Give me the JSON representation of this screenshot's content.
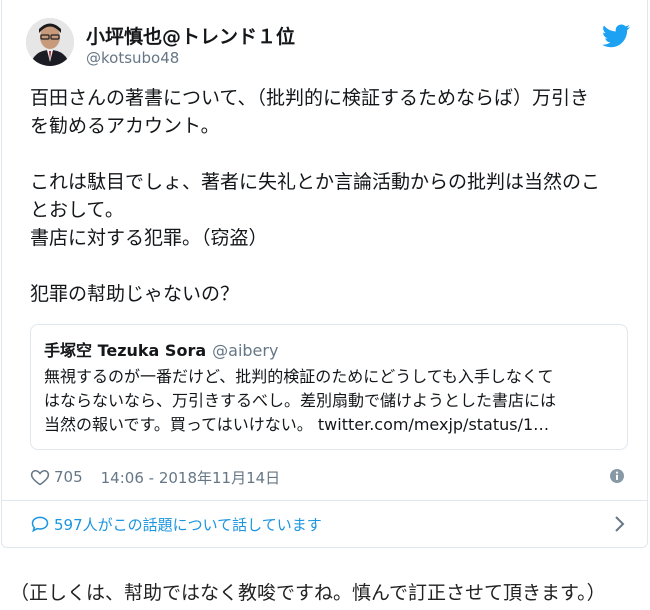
{
  "tweet": {
    "author_name": "小坪慎也@トレンド１位",
    "author_handle": "@kotsubo48",
    "lines": [
      "百田さんの著書について、（批判的に検証するためならば）万引き",
      "を勧めるアカウント。",
      "",
      "これは駄目でしょ、著者に失礼とか言論活動からの批判は当然のこ",
      "とおして。",
      "書店に対する犯罪。（窃盗）",
      "",
      "犯罪の幇助じゃないの？"
    ],
    "quote": {
      "name": "手塚空 Tezuka Sora",
      "handle": "@aibery",
      "lines": [
        "無視するのが一番だけど、批判的検証のためにどうしても入手しなくて",
        "はならないなら、万引きするべし。差別扇動で儲けようとした書店には",
        "当然の報いです。買ってはいけない。 twitter.com/mexjp/status/1…"
      ]
    },
    "likes": "705",
    "timestamp": "14:06 - 2018年11月14日",
    "replies_text": "597人がこの話題について話しています"
  },
  "footer_note": "（正しくは、幇助ではなく教唆ですね。慎んで訂正させて頂きます。）",
  "colors": {
    "accent": "#1da1f2",
    "link": "#1b95e0",
    "secondary_text": "#657786",
    "border": "#e1e8ed"
  },
  "icons": [
    "twitter-bird-icon",
    "heart-icon",
    "info-icon",
    "reply-bubble-icon",
    "chevron-right-icon"
  ]
}
